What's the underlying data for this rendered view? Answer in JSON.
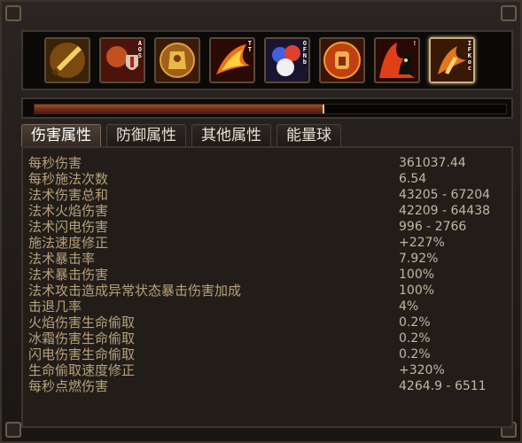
{
  "skills": [
    {
      "icon": "sword-skill-icon",
      "runes": [],
      "selected": false
    },
    {
      "icon": "shield-warrior-skill-icon",
      "runes": [
        "A",
        "O",
        "S"
      ],
      "selected": false
    },
    {
      "icon": "golden-armor-skill-icon",
      "runes": [],
      "selected": false
    },
    {
      "icon": "fire-wing-skill-icon",
      "runes": [
        "T",
        "T"
      ],
      "selected": false
    },
    {
      "icon": "triple-orb-skill-icon",
      "runes": [
        "O",
        "F",
        "N",
        "b"
      ],
      "selected": false
    },
    {
      "icon": "fire-fist-skill-icon",
      "runes": [],
      "selected": false
    },
    {
      "icon": "fire-demon-skill-icon",
      "runes": [
        "!"
      ],
      "selected": false
    },
    {
      "icon": "phoenix-claw-skill-icon",
      "runes": [
        "I",
        "F",
        "K",
        "o",
        "c"
      ],
      "selected": true
    }
  ],
  "progress": {
    "fraction": 0.61
  },
  "tabs": [
    {
      "label": "伤害属性",
      "active": true
    },
    {
      "label": "防御属性",
      "active": false
    },
    {
      "label": "其他属性",
      "active": false
    },
    {
      "label": "能量球",
      "active": false
    }
  ],
  "stats": [
    {
      "label": "每秒伤害",
      "value": "361037.44"
    },
    {
      "label": "每秒施法次数",
      "value": "6.54"
    },
    {
      "label": "法术伤害总和",
      "value": "43205 - 67204"
    },
    {
      "label": "法术火焰伤害",
      "value": "42209 - 64438"
    },
    {
      "label": "法术闪电伤害",
      "value": "996 - 2766"
    },
    {
      "label": "施法速度修正",
      "value": "+227%"
    },
    {
      "label": "法术暴击率",
      "value": "7.92%"
    },
    {
      "label": "法术暴击伤害",
      "value": "100%"
    },
    {
      "label": "法术攻击造成异常状态暴击伤害加成",
      "value": "100%"
    },
    {
      "label": "击退几率",
      "value": "4%"
    },
    {
      "label": "火焰伤害生命偷取",
      "value": "0.2%"
    },
    {
      "label": "冰霜伤害生命偷取",
      "value": "0.2%"
    },
    {
      "label": "闪电伤害生命偷取",
      "value": "0.2%"
    },
    {
      "label": "生命偷取速度修正",
      "value": "+320%"
    },
    {
      "label": "每秒点燃伤害",
      "value": "4264.9 - 6511"
    }
  ],
  "colors": {
    "label": "#b7a07a",
    "value": "#c3b7a2",
    "progress_fill": "#a44a2a"
  }
}
